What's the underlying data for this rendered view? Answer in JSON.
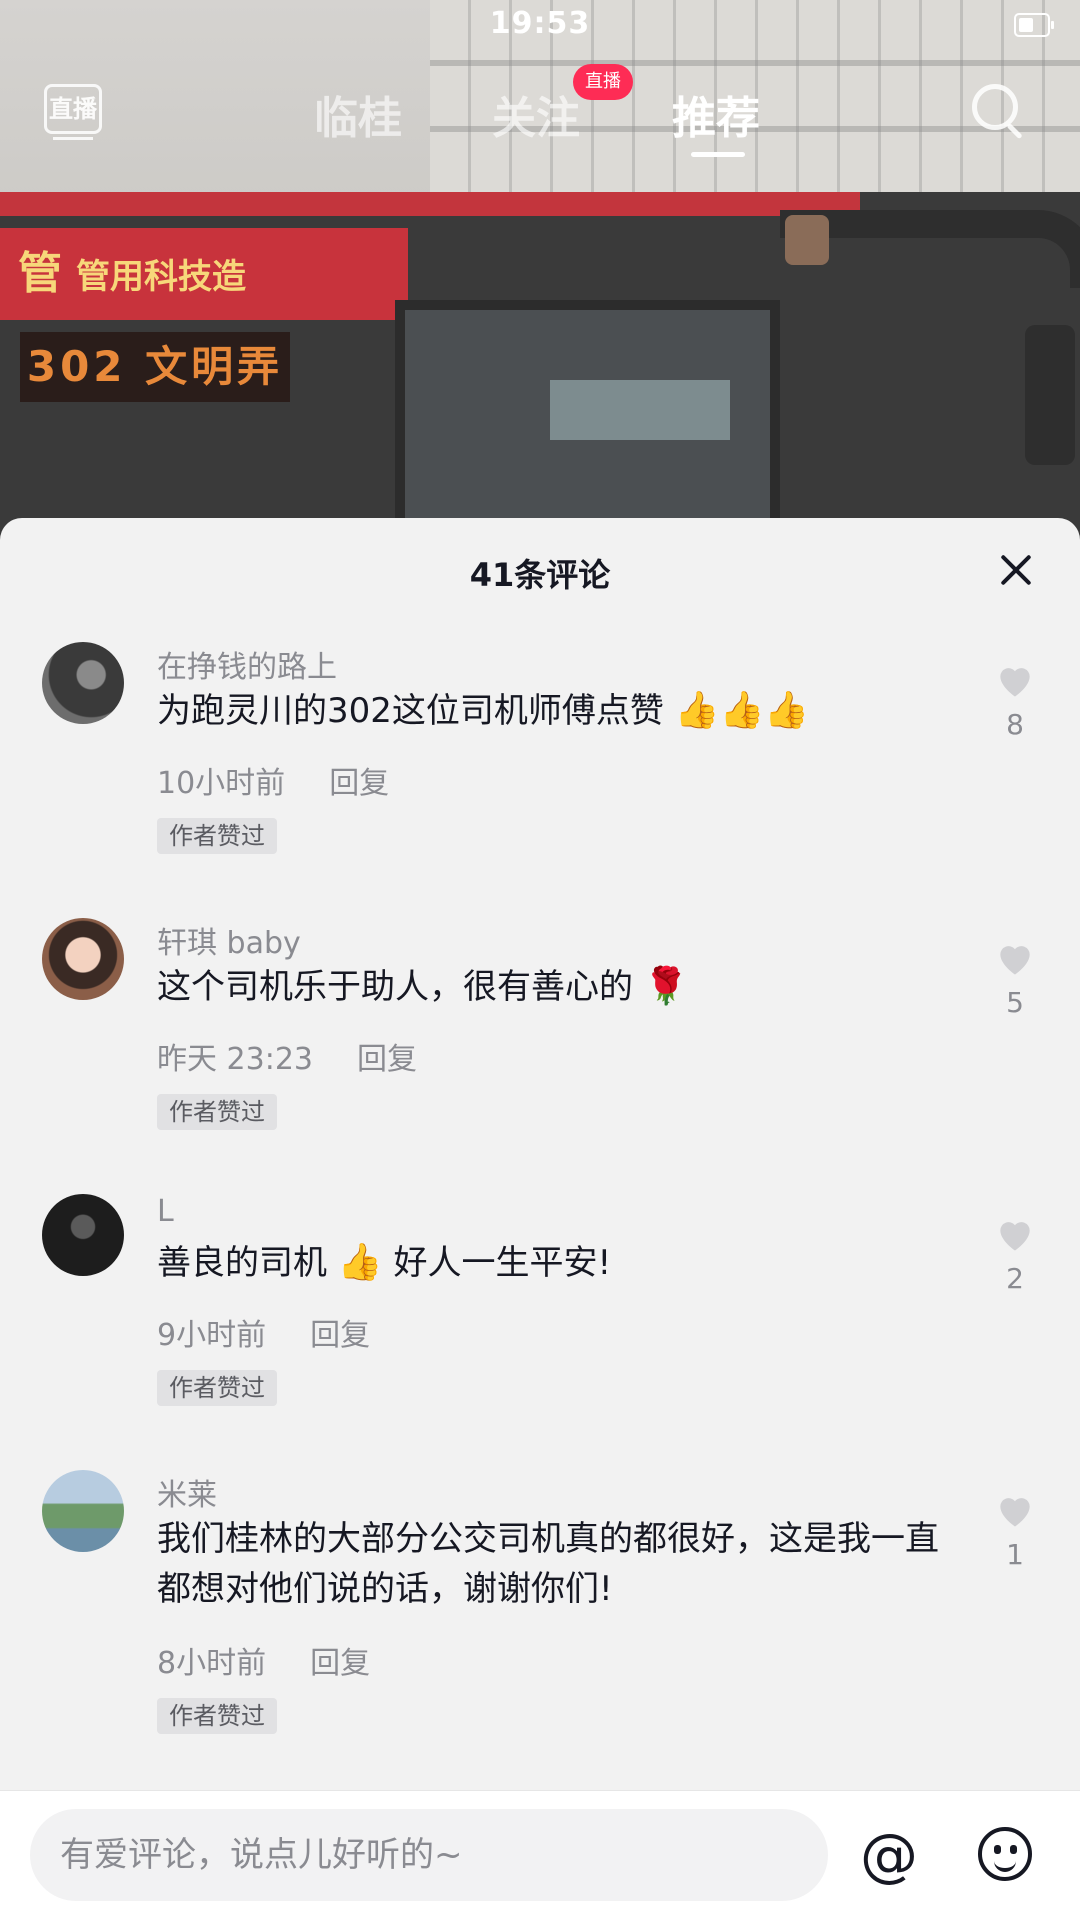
{
  "status_bar": {
    "time": "19:53"
  },
  "top_nav": {
    "live_label": "直播",
    "tabs": [
      {
        "label": "临桂",
        "active": false
      },
      {
        "label": "关注",
        "active": false,
        "badge": "直播"
      },
      {
        "label": "推荐",
        "active": true
      }
    ]
  },
  "video": {
    "bus_banner_prefix": "管",
    "bus_banner_text": "管用科技造",
    "bus_led_text": "302 文明弄"
  },
  "comments_panel": {
    "title": "41条评论",
    "comments": [
      {
        "username": "在挣钱的路上",
        "text": "为跑灵川的302这位司机师傅点赞",
        "emoji": "👍👍👍",
        "time": "10小时前",
        "reply_label": "回复",
        "author_tag": "作者赞过",
        "like_count": "8"
      },
      {
        "username": "轩琪 baby",
        "text": "这个司机乐于助人，很有善心的",
        "emoji": "🌹",
        "time": "昨天 23:23",
        "reply_label": "回复",
        "author_tag": "作者赞过",
        "like_count": "5"
      },
      {
        "username": "L",
        "text_before": "善良的司机",
        "emoji": "👍",
        "text_after": "好人一生平安!",
        "time": "9小时前",
        "reply_label": "回复",
        "author_tag": "作者赞过",
        "like_count": "2"
      },
      {
        "username": "米莱",
        "text": "我们桂林的大部分公交司机真的都很好，这是我一直都想对他们说的话，谢谢你们!",
        "time": "8小时前",
        "reply_label": "回复",
        "author_tag": "作者赞过",
        "like_count": "1"
      }
    ]
  },
  "input_bar": {
    "placeholder": "有爱评论，说点儿好听的~",
    "at_symbol": "@"
  },
  "colors": {
    "accent_badge": "#fe2c55",
    "text_primary": "#161823",
    "text_secondary": "#8a8b91",
    "panel_bg": "#f2f2f2"
  },
  "icons": [
    "live-icon",
    "search-icon",
    "close-icon",
    "heart-icon",
    "at-icon",
    "emoji-icon",
    "battery-icon"
  ]
}
